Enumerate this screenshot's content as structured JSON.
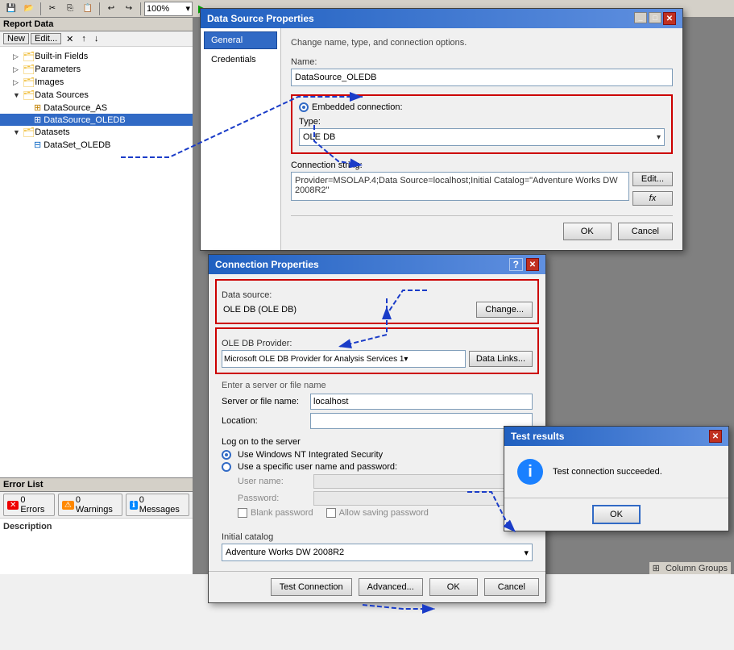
{
  "ide": {
    "toolbar": {
      "zoom": "100%"
    }
  },
  "leftPanel": {
    "title": "Report Data",
    "menu": {
      "new": "New",
      "edit": "Edit..."
    },
    "tree": {
      "items": [
        {
          "label": "Built-in Fields",
          "level": 1,
          "type": "folder",
          "expanded": false
        },
        {
          "label": "Parameters",
          "level": 1,
          "type": "folder",
          "expanded": false
        },
        {
          "label": "Images",
          "level": 1,
          "type": "folder",
          "expanded": false
        },
        {
          "label": "Data Sources",
          "level": 1,
          "type": "folder",
          "expanded": true
        },
        {
          "label": "DataSource_AS",
          "level": 2,
          "type": "datasource"
        },
        {
          "label": "DataSource_OLEDB",
          "level": 2,
          "type": "datasource",
          "selected": true
        },
        {
          "label": "Datasets",
          "level": 1,
          "type": "folder",
          "expanded": true
        },
        {
          "label": "DataSet_OLEDB",
          "level": 2,
          "type": "dataset"
        }
      ]
    }
  },
  "errorPanel": {
    "title": "Error List",
    "errors": {
      "label": "0 Errors",
      "count": "0"
    },
    "warnings": {
      "label": "0 Warnings",
      "count": "0"
    },
    "messages": {
      "label": "0 Messages",
      "count": "0"
    },
    "description_header": "Description"
  },
  "columnGroups": "Column Groups",
  "dsPropsDialog": {
    "title": "Data Source Properties",
    "tabs": {
      "general": "General",
      "credentials": "Credentials"
    },
    "subtitle": "Change name, type, and connection options.",
    "name_label": "Name:",
    "name_value": "DataSource_OLEDB",
    "embedded_label": "Embedded connection:",
    "type_label": "Type:",
    "type_value": "OLE DB",
    "conn_string_label": "Connection string:",
    "conn_string_value": "Provider=MSOLAP.4;Data Source=localhost;Initial Catalog=\"Adventure Works DW 2008R2\"",
    "edit_btn": "Edit...",
    "fx_btn": "fx",
    "footer": {
      "ok": "OK",
      "cancel": "Cancel"
    }
  },
  "connPropsDialog": {
    "title": "Connection Properties",
    "data_source_label": "Data source:",
    "data_source_value": "OLE DB (OLE DB)",
    "change_btn": "Change...",
    "provider_label": "OLE DB Provider:",
    "provider_value": "Microsoft OLE DB Provider for Analysis Services 1",
    "data_links_btn": "Data Links...",
    "server_hint": "Enter a server or file name",
    "server_label": "Server or file name:",
    "server_value": "localhost",
    "location_label": "Location:",
    "location_value": "",
    "logon_title": "Log on to the server",
    "nt_security": "Use Windows NT Integrated Security",
    "specific_user": "Use a specific user name and password:",
    "username_label": "User name:",
    "password_label": "Password:",
    "blank_password": "Blank password",
    "allow_saving": "Allow saving password",
    "catalog_label": "Initial catalog",
    "catalog_value": "Adventure Works DW 2008R2",
    "advanced_btn": "Advanced...",
    "test_btn": "Test Connection",
    "ok_btn": "OK",
    "cancel_btn": "Cancel",
    "help_icon": "?",
    "close_icon": "✕"
  },
  "testDialog": {
    "title": "Test results",
    "message": "Test connection succeeded.",
    "ok_btn": "OK",
    "close_icon": "✕",
    "info_icon": "i"
  }
}
